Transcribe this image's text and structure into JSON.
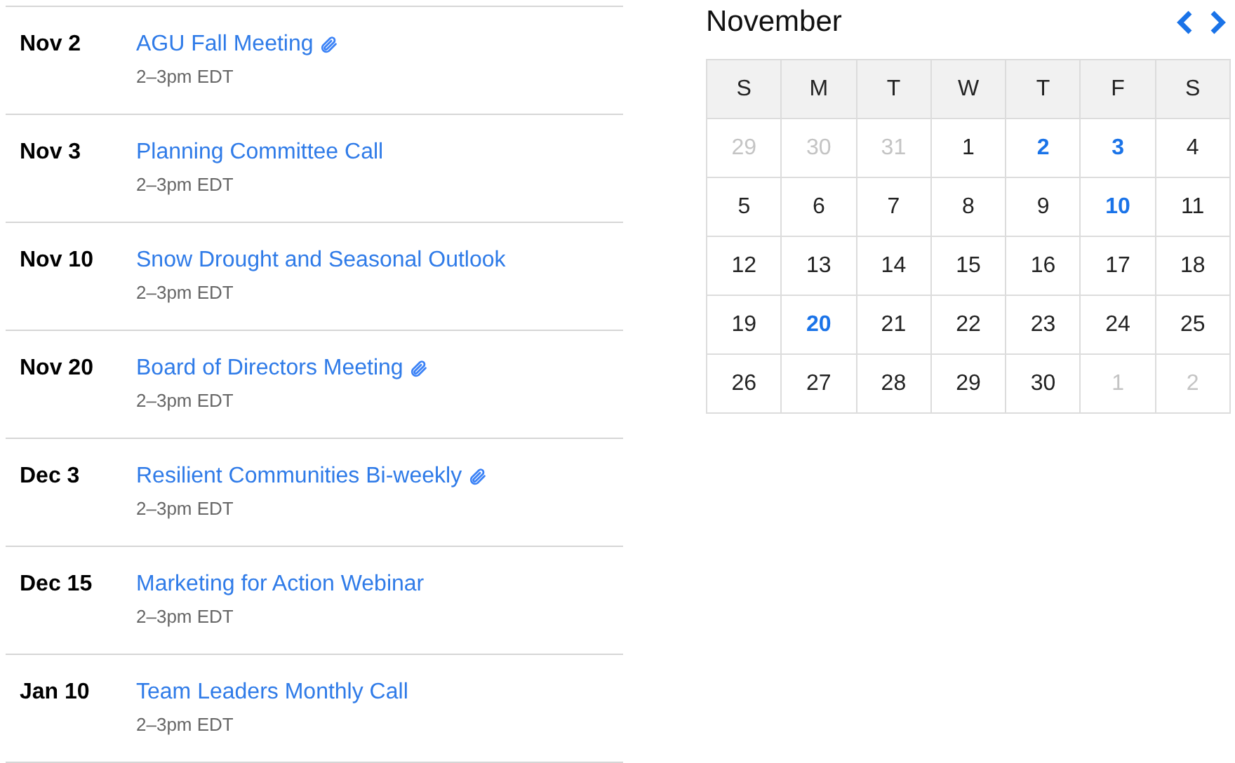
{
  "events": [
    {
      "date": "Nov 2",
      "title": "AGU Fall Meeting",
      "time": "2–3pm EDT",
      "attachment": true
    },
    {
      "date": "Nov 3",
      "title": "Planning Committee Call",
      "time": "2–3pm EDT",
      "attachment": false
    },
    {
      "date": "Nov 10",
      "title": "Snow Drought and Seasonal Outlook",
      "time": "2–3pm EDT",
      "attachment": false
    },
    {
      "date": "Nov 20",
      "title": "Board of Directors Meeting",
      "time": "2–3pm EDT",
      "attachment": true
    },
    {
      "date": "Dec 3",
      "title": "Resilient Communities Bi-weekly",
      "time": "2–3pm EDT",
      "attachment": true
    },
    {
      "date": "Dec 15",
      "title": "Marketing for Action Webinar",
      "time": "2–3pm EDT",
      "attachment": false
    },
    {
      "date": "Jan 10",
      "title": "Team Leaders Monthly Call",
      "time": "2–3pm EDT",
      "attachment": false
    }
  ],
  "calendar": {
    "month": "November",
    "weekdays": [
      "S",
      "M",
      "T",
      "W",
      "T",
      "F",
      "S"
    ],
    "weeks": [
      [
        {
          "day": "29",
          "kind": "outside"
        },
        {
          "day": "30",
          "kind": "outside"
        },
        {
          "day": "31",
          "kind": "outside"
        },
        {
          "day": "1",
          "kind": "plain"
        },
        {
          "day": "2",
          "kind": "event"
        },
        {
          "day": "3",
          "kind": "event"
        },
        {
          "day": "4",
          "kind": "plain"
        }
      ],
      [
        {
          "day": "5",
          "kind": "plain"
        },
        {
          "day": "6",
          "kind": "plain"
        },
        {
          "day": "7",
          "kind": "plain"
        },
        {
          "day": "8",
          "kind": "plain"
        },
        {
          "day": "9",
          "kind": "plain"
        },
        {
          "day": "10",
          "kind": "event"
        },
        {
          "day": "11",
          "kind": "plain"
        }
      ],
      [
        {
          "day": "12",
          "kind": "plain"
        },
        {
          "day": "13",
          "kind": "plain"
        },
        {
          "day": "14",
          "kind": "plain"
        },
        {
          "day": "15",
          "kind": "plain"
        },
        {
          "day": "16",
          "kind": "plain"
        },
        {
          "day": "17",
          "kind": "plain"
        },
        {
          "day": "18",
          "kind": "plain"
        }
      ],
      [
        {
          "day": "19",
          "kind": "plain"
        },
        {
          "day": "20",
          "kind": "event"
        },
        {
          "day": "21",
          "kind": "plain"
        },
        {
          "day": "22",
          "kind": "plain"
        },
        {
          "day": "23",
          "kind": "plain"
        },
        {
          "day": "24",
          "kind": "plain"
        },
        {
          "day": "25",
          "kind": "plain"
        }
      ],
      [
        {
          "day": "26",
          "kind": "plain"
        },
        {
          "day": "27",
          "kind": "plain"
        },
        {
          "day": "28",
          "kind": "plain"
        },
        {
          "day": "29",
          "kind": "plain"
        },
        {
          "day": "30",
          "kind": "plain"
        },
        {
          "day": "1",
          "kind": "outside"
        },
        {
          "day": "2",
          "kind": "outside"
        }
      ]
    ]
  }
}
